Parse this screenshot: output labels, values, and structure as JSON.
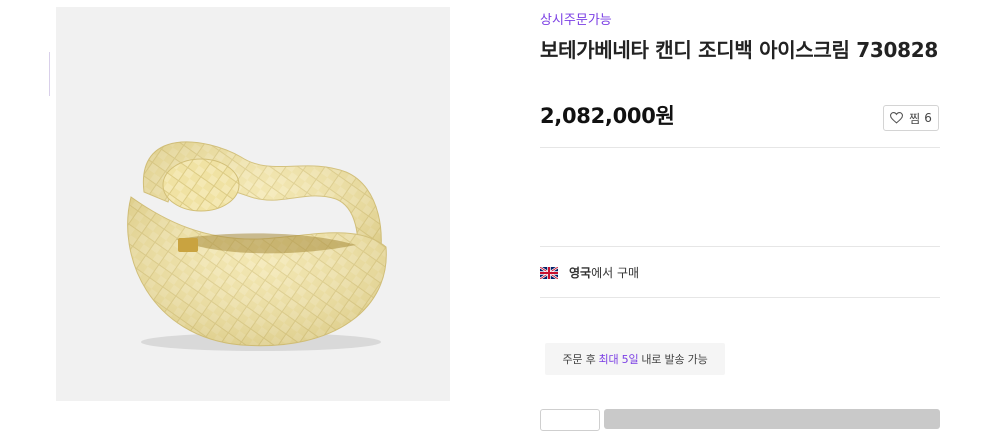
{
  "product": {
    "availability_badge": "상시주문가능",
    "title": "보테가베네타 캔디 조디백 아이스크림 730828",
    "price": "2,082,000원",
    "image_icon": "woven-handbag-image"
  },
  "wishlist": {
    "label": "찜",
    "count": "6",
    "icon": "heart-icon"
  },
  "origin": {
    "flag_icon": "uk-flag-icon",
    "country": "영국",
    "suffix": "에서 구매"
  },
  "shipping": {
    "prefix": "주문 후",
    "highlight": "최대 5일",
    "suffix": "내로 발송 가능"
  },
  "colors": {
    "accent": "#7b3fe4",
    "bag": "#f0e2a3",
    "image_bg": "#f1f1f1"
  }
}
